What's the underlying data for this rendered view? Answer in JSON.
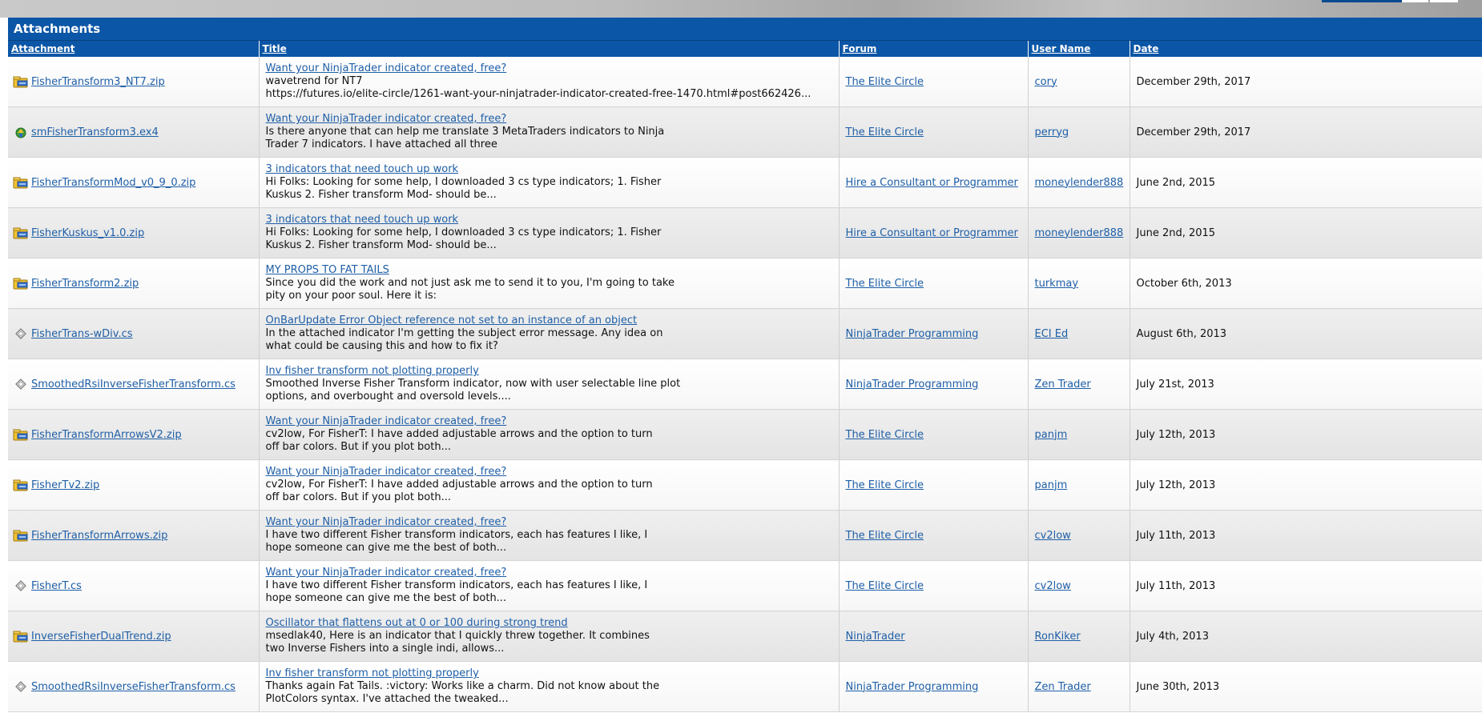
{
  "panel_title": "Attachments",
  "columns": {
    "attachment": "Attachment",
    "title": "Title",
    "forum": "Forum",
    "user": "User Name",
    "date": "Date"
  },
  "rows": [
    {
      "icon": "zip-icon",
      "attachment": "FisherTransform3_NT7.zip",
      "title": "Want your NinjaTrader indicator created, free?",
      "snippet": "wavetrend for NT7\nhttps://futures.io/elite-circle/1261-want-your-ninjatrader-indicator-created-free-1470.html#post662426...",
      "forum": "The Elite Circle",
      "user": "cory",
      "date": "December 29th, 2017"
    },
    {
      "icon": "ex4-icon",
      "attachment": "smFisherTransform3.ex4",
      "title": "Want your NinjaTrader indicator created, free?",
      "snippet": "Is there anyone that can help me translate 3 MetaTraders indicators to Ninja\nTrader 7 indicators. I have attached all three",
      "forum": "The Elite Circle",
      "user": "perryg",
      "date": "December 29th, 2017"
    },
    {
      "icon": "zip-icon",
      "attachment": "FisherTransformMod_v0_9_0.zip",
      "title": "3 indicators that need touch up work",
      "snippet": "Hi Folks: Looking for some help, I downloaded 3 cs type indicators; 1. Fisher\nKuskus 2. Fisher transform Mod- should be...",
      "forum": "Hire a Consultant or Programmer",
      "user": "moneylender888",
      "date": "June 2nd, 2015"
    },
    {
      "icon": "zip-icon",
      "attachment": "FisherKuskus_v1.0.zip",
      "title": "3 indicators that need touch up work",
      "snippet": "Hi Folks: Looking for some help, I downloaded 3 cs type indicators; 1. Fisher\nKuskus 2. Fisher transform Mod- should be...",
      "forum": "Hire a Consultant or Programmer",
      "user": "moneylender888",
      "date": "June 2nd, 2015"
    },
    {
      "icon": "zip-icon",
      "attachment": "FisherTransform2.zip",
      "title": "MY PROPS TO FAT TAILS",
      "snippet": "Since you did the work and not just ask me to send it to you, I'm going to take\npity on your poor soul. Here it is:",
      "forum": "The Elite Circle",
      "user": "turkmay",
      "date": "October 6th, 2013"
    },
    {
      "icon": "cs-file-icon",
      "attachment": "FisherTrans-wDiv.cs",
      "title": "OnBarUpdate Error Object reference not set to an instance of an object",
      "snippet": "In the attached indicator I'm getting the subject error message. Any idea on\nwhat could be causing this and how to fix it?",
      "forum": "NinjaTrader Programming",
      "user": "ECI Ed",
      "date": "August 6th, 2013"
    },
    {
      "icon": "cs-file-icon",
      "attachment": "SmoothedRsiInverseFisherTransform.cs",
      "title": "Inv fisher transform not plotting properly",
      "snippet": "Smoothed Inverse Fisher Transform indicator, now with user selectable line plot\noptions, and overbought and oversold levels....",
      "forum": "NinjaTrader Programming",
      "user": "Zen Trader",
      "date": "July 21st, 2013"
    },
    {
      "icon": "zip-icon",
      "attachment": "FisherTransformArrowsV2.zip",
      "title": "Want your NinjaTrader indicator created, free?",
      "snippet": "cv2low, For FisherT: I have added adjustable arrows and the option to turn\noff bar colors. But if you plot both...",
      "forum": "The Elite Circle",
      "user": "panjm",
      "date": "July 12th, 2013"
    },
    {
      "icon": "zip-icon",
      "attachment": "FisherTv2.zip",
      "title": "Want your NinjaTrader indicator created, free?",
      "snippet": "cv2low, For FisherT: I have added adjustable arrows and the option to turn\noff bar colors. But if you plot both...",
      "forum": "The Elite Circle",
      "user": "panjm",
      "date": "July 12th, 2013"
    },
    {
      "icon": "zip-icon",
      "attachment": "FisherTransformArrows.zip",
      "title": "Want your NinjaTrader indicator created, free?",
      "snippet": "I have two different Fisher transform indicators, each has features I like, I\nhope someone can give me the best of both...",
      "forum": "The Elite Circle",
      "user": "cv2low",
      "date": "July 11th, 2013"
    },
    {
      "icon": "cs-file-icon",
      "attachment": "FisherT.cs",
      "title": "Want your NinjaTrader indicator created, free?",
      "snippet": "I have two different Fisher transform indicators, each has features I like, I\nhope someone can give me the best of both...",
      "forum": "The Elite Circle",
      "user": "cv2low",
      "date": "July 11th, 2013"
    },
    {
      "icon": "zip-icon",
      "attachment": "InverseFisherDualTrend.zip",
      "title": "Oscillator that flattens out at 0 or 100 during strong trend",
      "snippet": "msedlak40, Here is an indicator that I quickly threw together. It combines\ntwo Inverse Fishers into a single indi, allows...",
      "forum": "NinjaTrader",
      "user": "RonKiker",
      "date": "July 4th, 2013"
    },
    {
      "icon": "cs-file-icon",
      "attachment": "SmoothedRsiInverseFisherTransform.cs",
      "title": "Inv fisher transform not plotting properly",
      "snippet": "Thanks again Fat Tails. :victory: Works like a charm. Did not know about the\nPlotColors syntax. I've attached the tweaked...",
      "forum": "NinjaTrader Programming",
      "user": "Zen Trader",
      "date": "June 30th, 2013"
    }
  ]
}
